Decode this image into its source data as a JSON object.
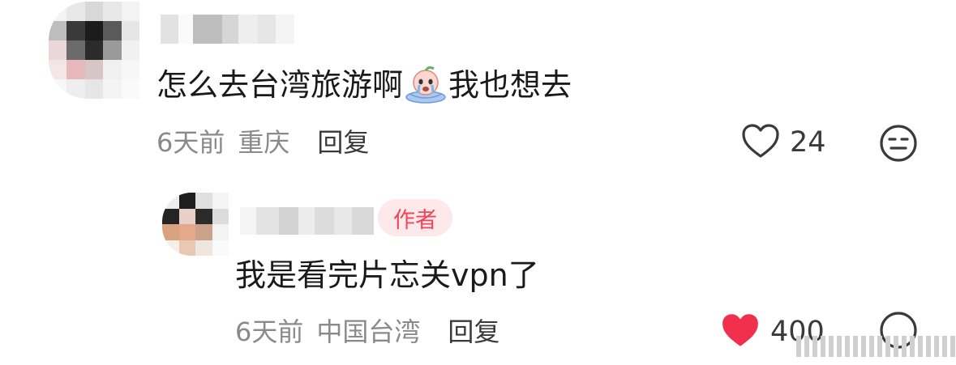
{
  "comment": {
    "avatar_blur": [
      "#f4f4f4",
      "#e8e8e8",
      "#d8d8d8",
      "#e8e8e8",
      "#f3f3f3",
      "#bdbdbd",
      "#3a3a3a",
      "#1c1c1c",
      "#5a5a5a",
      "#e6e6e6",
      "#e9d7d9",
      "#6b6b6b",
      "#2b2b2b",
      "#9a9a9a",
      "#f1f1f1",
      "#f2e6e6",
      "#e6b8bb",
      "#d8c6c7",
      "#f0f0f0",
      "#f7f7f7",
      "#f7f7f7",
      "#eeeeee",
      "#e6e6e6",
      "#f4f4f4",
      "#fafafa"
    ],
    "text": "怎么去台湾旅游啊",
    "text_after_emoji": "我也想去",
    "emoji_icon": "crying-peach-emoji",
    "time": "6天前",
    "location": "重庆",
    "reply_label": "回复",
    "like_count": "24",
    "like_icon": "heart-outline-icon",
    "dislike_icon": "meh-face-icon"
  },
  "reply": {
    "avatar_blur": [
      "#eeeeee",
      "#1e1e1e",
      "#e0e0e0",
      "#f5f5f5",
      "#242424",
      "#e8cfc8",
      "#2b2b2b",
      "#dcdcdc",
      "#d9a37f",
      "#e4a98a",
      "#caa28a",
      "#f3f3f3",
      "#f6efe9",
      "#e9c8b3",
      "#f0e6e0",
      "#fafafa"
    ],
    "author_badge": "作者",
    "text": "我是看完片忘关vpn了",
    "time": "6天前",
    "location": "中国台湾",
    "reply_label": "回复",
    "like_count": "400",
    "like_icon": "heart-filled-icon",
    "liked_color": "#f0304d"
  }
}
